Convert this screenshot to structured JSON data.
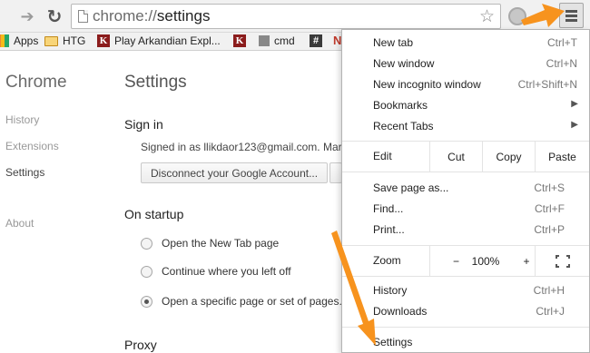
{
  "toolbar": {
    "url_scheme": "chrome://",
    "url_path": "settings",
    "forward_icon": "forward-arrow-icon",
    "reload_icon": "reload-icon",
    "bookmark_icon": "star-icon",
    "menu_icon": "hamburger-menu-icon"
  },
  "bookmarks": [
    {
      "label": "Apps",
      "icon": "apps-icon"
    },
    {
      "label": "HTG",
      "icon": "folder-icon"
    },
    {
      "label": "Play Arkandian Expl...",
      "icon": "k-icon"
    },
    {
      "label": "",
      "icon": "k-icon"
    },
    {
      "label": "cmd",
      "icon": "cmd-icon"
    },
    {
      "label": "",
      "icon": "hash-icon"
    },
    {
      "label": "",
      "icon": "n-icon"
    }
  ],
  "sidebar": {
    "title": "Chrome",
    "items": [
      "History",
      "Extensions",
      "Settings",
      "About"
    ]
  },
  "settings": {
    "title": "Settings",
    "sign_in": {
      "heading": "Sign in",
      "signed_text": "Signed in as llikdaor123@gmail.com. Mar",
      "disconnect_button": "Disconnect your Google Account..."
    },
    "startup": {
      "heading": "On startup",
      "options": [
        {
          "label": "Open the New Tab page",
          "checked": false
        },
        {
          "label": "Continue where you left off",
          "checked": false
        },
        {
          "label": "Open a specific page or set of pages.",
          "checked": true
        }
      ]
    },
    "proxy_heading": "Proxy"
  },
  "menu": {
    "new_tab": {
      "label": "New tab",
      "shortcut": "Ctrl+T"
    },
    "new_window": {
      "label": "New window",
      "shortcut": "Ctrl+N"
    },
    "new_incognito": {
      "label": "New incognito window",
      "shortcut": "Ctrl+Shift+N"
    },
    "bookmarks": {
      "label": "Bookmarks"
    },
    "recent_tabs": {
      "label": "Recent Tabs"
    },
    "edit": {
      "label": "Edit",
      "cut": "Cut",
      "copy": "Copy",
      "paste": "Paste"
    },
    "save_page": {
      "label": "Save page as...",
      "shortcut": "Ctrl+S"
    },
    "find": {
      "label": "Find...",
      "shortcut": "Ctrl+F"
    },
    "print": {
      "label": "Print...",
      "shortcut": "Ctrl+P"
    },
    "zoom": {
      "label": "Zoom",
      "minus": "−",
      "value": "100%",
      "plus": "+"
    },
    "history": {
      "label": "History",
      "shortcut": "Ctrl+H"
    },
    "downloads": {
      "label": "Downloads",
      "shortcut": "Ctrl+J"
    },
    "settings": {
      "label": "Settings"
    }
  },
  "colors": {
    "annotation_arrow": "#f7931e"
  }
}
